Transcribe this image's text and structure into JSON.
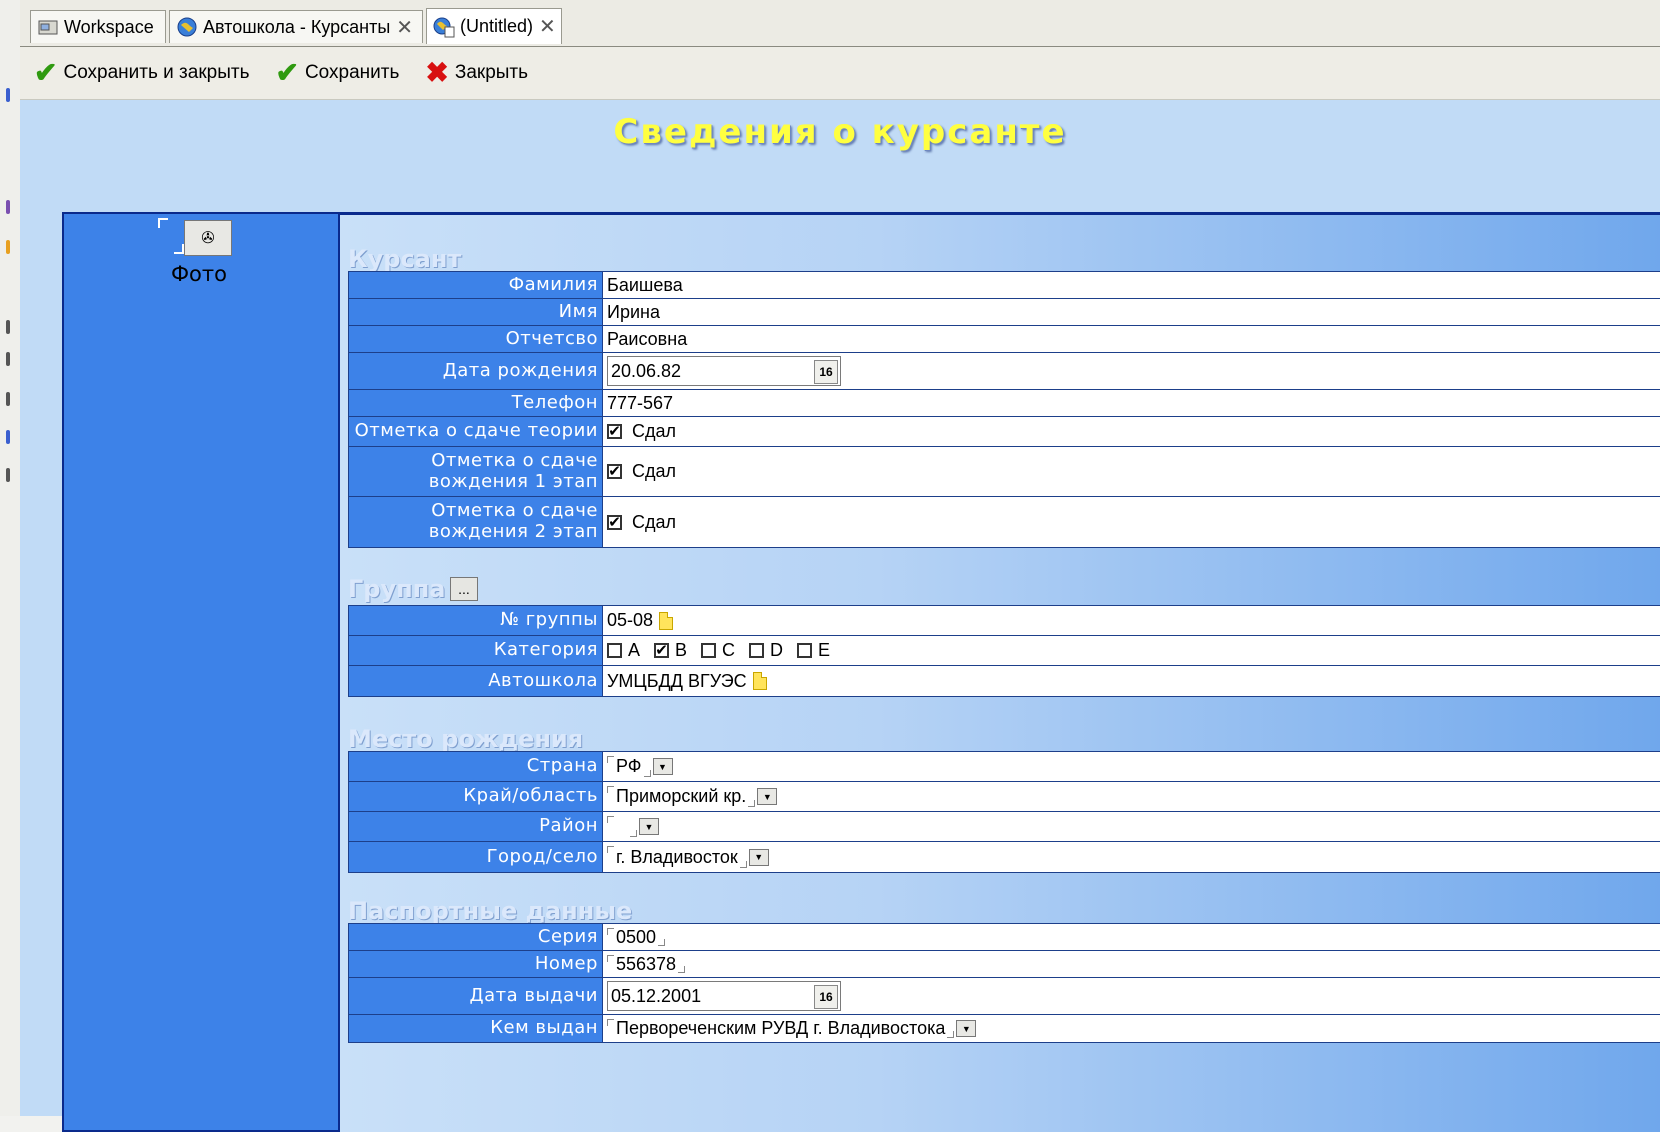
{
  "tabs": [
    {
      "label": "Workspace",
      "icon": "workspace-icon"
    },
    {
      "label": "Автошкола - Курсанты",
      "icon": "globe-icon"
    },
    {
      "label": "(Untitled)",
      "icon": "document-globe-icon"
    }
  ],
  "toolbar": {
    "save_close": "Сохранить и закрыть",
    "save": "Сохранить",
    "close": "Закрыть"
  },
  "form_title": "Сведения о курсанте",
  "photo": {
    "label": "Фото"
  },
  "sections": {
    "cadet": {
      "title": "Курсант",
      "last_name_label": "Фамилия",
      "last_name": "Баишева",
      "first_name_label": "Имя",
      "first_name": "Ирина",
      "patronymic_label": "Отчетсво",
      "patronymic": "Раисовна",
      "birth_date_label": "Дата рождения",
      "birth_date": "20.06.82",
      "phone_label": "Телефон",
      "phone": "777-567",
      "theory_label": "Отметка о сдаче теории",
      "theory_value": "Сдал",
      "driving1_label_1": "Отметка о сдаче",
      "driving1_label_2": "вождения 1 этап",
      "driving1_value": "Сдал",
      "driving2_label_1": "Отметка о сдаче",
      "driving2_label_2": "вождения 2 этап",
      "driving2_value": "Сдал"
    },
    "group": {
      "title": "Группа",
      "ellipsis": "...",
      "number_label": "№ группы",
      "number": "05-08",
      "category_label": "Категория",
      "categories": [
        {
          "label": "A",
          "checked": false
        },
        {
          "label": "B",
          "checked": true
        },
        {
          "label": "C",
          "checked": false
        },
        {
          "label": "D",
          "checked": false
        },
        {
          "label": "E",
          "checked": false
        }
      ],
      "school_label": "Автошкола",
      "school": "УМЦБДД ВГУЭС"
    },
    "birthplace": {
      "title": "Место рождения",
      "country_label": "Страна",
      "country": "РФ",
      "region_label": "Край/область",
      "region": "Приморский кр.",
      "district_label": "Район",
      "district": "",
      "city_label": "Город/село",
      "city": "г. Владивосток"
    },
    "passport": {
      "title": "Паспортные данные",
      "series_label": "Серия",
      "series": "0500",
      "number_label": "Номер",
      "number": "556378",
      "issue_date_label": "Дата выдачи",
      "issue_date": "05.12.2001",
      "issued_by_label": "Кем выдан",
      "issued_by": "Первореченским РУВД г. Владивостока"
    }
  },
  "calendar_button": "16",
  "colors": {
    "accent": "#3d82e8",
    "title": "#ffff40",
    "border": "#0a2a8c"
  }
}
